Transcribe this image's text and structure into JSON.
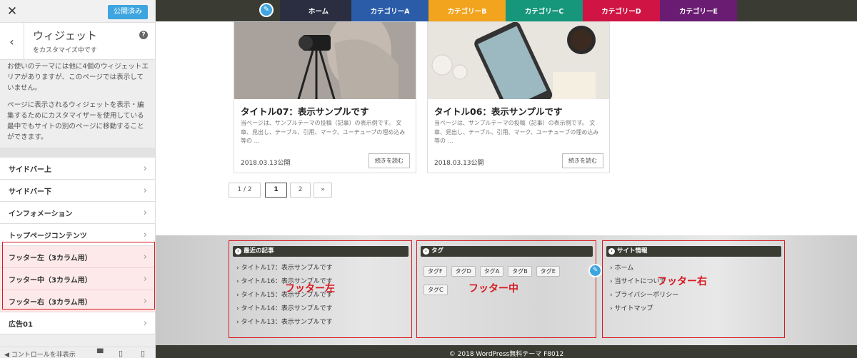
{
  "panel": {
    "close_symbol": "✕",
    "publish_label": "公開済み",
    "back_symbol": "‹",
    "section_title": "ウィジェット",
    "section_subtitle": "をカスタマイズ中です",
    "help_symbol": "?",
    "description_1": "お使いのテーマには他に4個のウィジェットエリアがありますが、このページでは表示していません。",
    "description_2": "ページに表示されるウィジェットを表示・編集するためにカスタマイザーを使用している最中でもサイトの別のページに移動することができます。",
    "widget_areas": [
      {
        "label": "サイドバー上"
      },
      {
        "label": "サイドバー下"
      },
      {
        "label": "インフォメーション"
      },
      {
        "label": "トップページコンテンツ"
      },
      {
        "label": "フッター左（3カラム用）"
      },
      {
        "label": "フッター中（3カラム用）"
      },
      {
        "label": "フッター右（3カラム用）"
      },
      {
        "label": "広告01"
      }
    ],
    "chevron": "›",
    "collapse_label": "◀ コントロールを非表示",
    "device_icons": [
      "desktop-icon",
      "tablet-icon",
      "mobile-icon"
    ]
  },
  "nav": {
    "items": [
      {
        "label": "ホーム",
        "color": "#2b2e40"
      },
      {
        "label": "カテゴリーA",
        "color": "#2a5ca8"
      },
      {
        "label": "カテゴリーB",
        "color": "#f2a41f"
      },
      {
        "label": "カテゴリーC",
        "color": "#16967a"
      },
      {
        "label": "カテゴリーD",
        "color": "#d01443"
      },
      {
        "label": "カテゴリーE",
        "color": "#6a1c72"
      }
    ],
    "edit_symbol": "✎"
  },
  "cards": [
    {
      "title": "タイトル07：表示サンプルです",
      "excerpt": "当ページは、サンプルテーマの投稿（記事）の表示例です。 文章、見出し、テーブル、引用、マーク、ユーチューブの埋め込み等の …",
      "date": "2018.03.13公開",
      "more_label": "続きを読む"
    },
    {
      "title": "タイトル06：表示サンプルです",
      "excerpt": "当ページは、サンプルテーマの投稿（記事）の表示例です。 文章、見出し、テーブル、引用、マーク、ユーチューブの埋め込み等の …",
      "date": "2018.03.13公開",
      "more_label": "続きを読む"
    }
  ],
  "pagination": {
    "info": "1 / 2",
    "pages": [
      "1",
      "2"
    ],
    "next": "»"
  },
  "footer": {
    "recent": {
      "heading": "最近の記事",
      "items": [
        "タイトル17：表示サンプルです",
        "タイトル16：表示サンプルです",
        "タイトル15：表示サンプルです",
        "タイトル14：表示サンプルです",
        "タイトル13：表示サンプルです"
      ],
      "overlay_label": "フッター左"
    },
    "tags": {
      "heading": "タグ",
      "items": [
        "タグF",
        "タグD",
        "タグA",
        "タグB",
        "タグE",
        "タグC"
      ],
      "overlay_label": "フッター中"
    },
    "site_info": {
      "heading": "サイト情報",
      "items": [
        "ホーム",
        "当サイトについて",
        "プライバシーポリシー",
        "サイトマップ"
      ],
      "overlay_label": "フッター右"
    },
    "bullet": "›",
    "edit_symbol": "✎",
    "copyright": "© 2018 WordPress無料テーマ F8012"
  }
}
